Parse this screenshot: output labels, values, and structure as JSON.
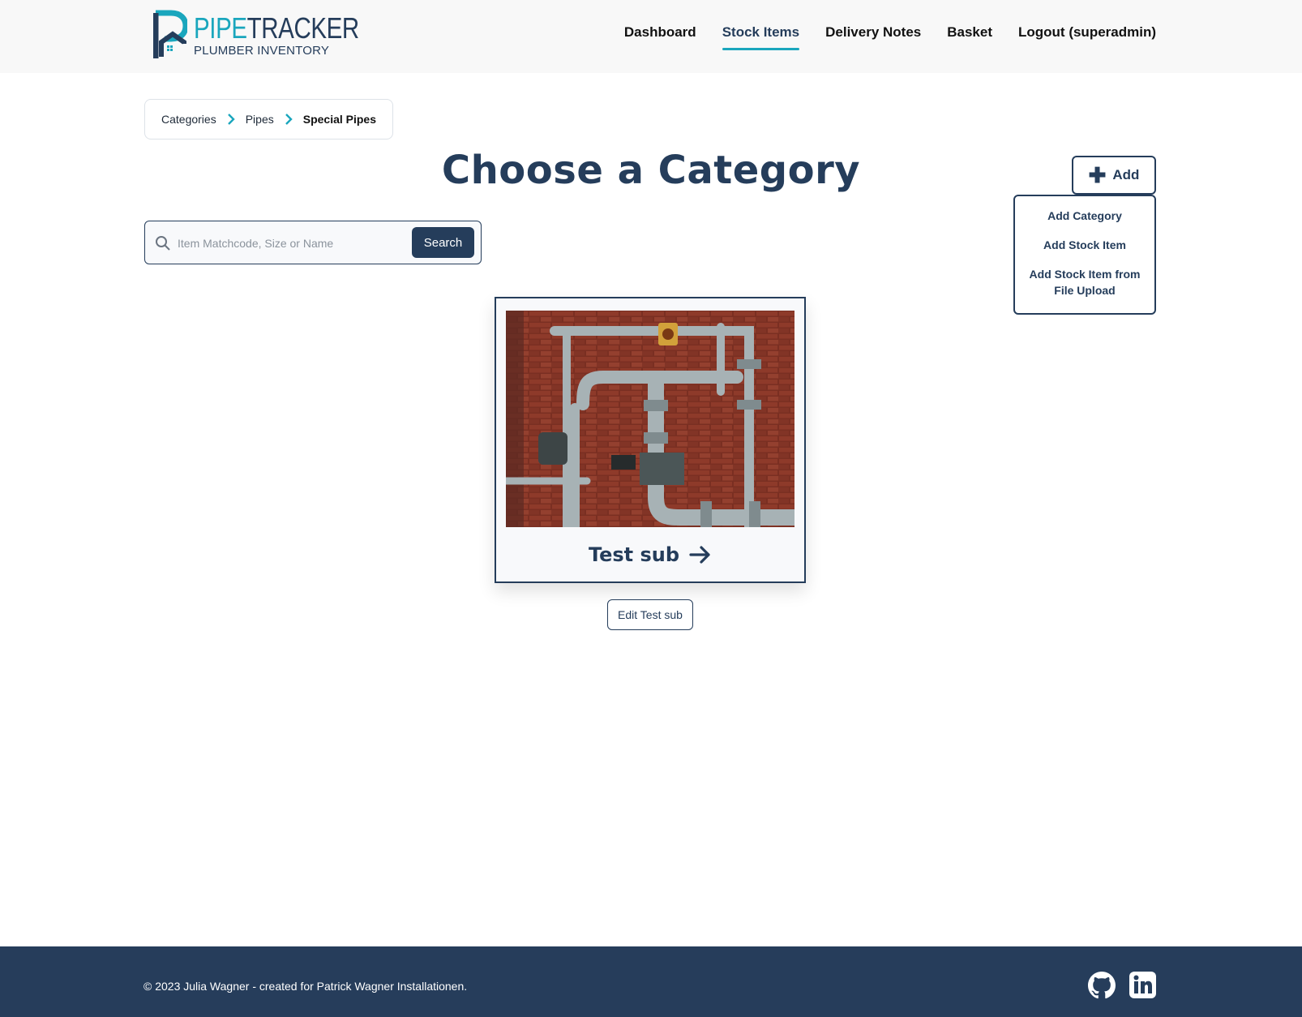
{
  "brand": {
    "name_part1": "PIPE",
    "name_part2": "TRACKER",
    "subtitle": "PLUMBER INVENTORY",
    "accent_color": "#1aa6bd",
    "primary_color": "#253d5b"
  },
  "nav": {
    "items": [
      {
        "label": "Dashboard",
        "active": false
      },
      {
        "label": "Stock Items",
        "active": true
      },
      {
        "label": "Delivery Notes",
        "active": false
      },
      {
        "label": "Basket",
        "active": false
      },
      {
        "label": "Logout (superadmin)",
        "active": false
      }
    ]
  },
  "breadcrumb": {
    "items": [
      "Categories",
      "Pipes",
      "Special Pipes"
    ]
  },
  "page": {
    "title": "Choose a Category"
  },
  "add_menu": {
    "button_label": "Add",
    "items": [
      "Add Category",
      "Add Stock Item",
      "Add Stock Item from File Upload"
    ]
  },
  "search": {
    "placeholder": "Item Matchcode, Size or Name",
    "value": "",
    "button_label": "Search"
  },
  "category_card": {
    "label": "Test sub",
    "image_icon": "pipes-on-brick-wall-photo",
    "edit_label": "Edit Test sub"
  },
  "footer": {
    "copyright": "© 2023 Julia Wagner - created for Patrick Wagner Installationen.",
    "icons": [
      "github-icon",
      "linkedin-icon"
    ],
    "background_color": "#263d5b"
  }
}
